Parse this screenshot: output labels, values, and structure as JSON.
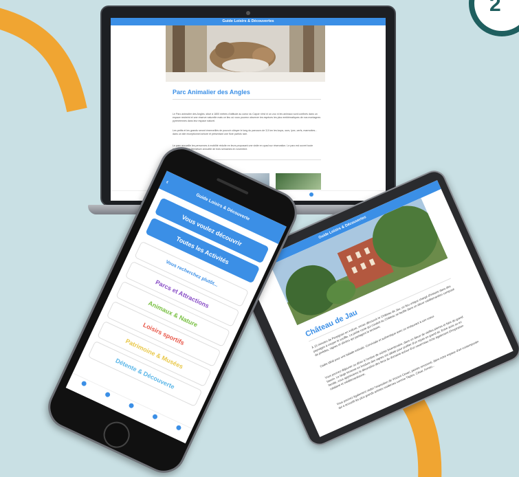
{
  "colors": {
    "background": "#c9e0e4",
    "accent": "#3b8fe6",
    "orange": "#f0a532",
    "teal_dark": "#1f5f5f"
  },
  "laptop": {
    "app_title": "Guide Loisirs & Découvertes",
    "page_title": "Parc Animalier des Angles",
    "paragraphs": [
      "Le Parc animalier des Angles, situé à 1800 mètres d'altitude au coeur du Capcir n'est ni un zoo ni les animaux sont confinés dans un espace restreint et une réserve naturelle mais ce lieu où vous pourrez observer les espèces les plus emblématiques de nos montagnes pyrénéennes dans leur espace naturel.",
      "Les petits et les grands seront émerveillés de pouvoir côtoyer le long du parcours de 3,5 km les loups, ours, lynx, cerfs, marmottes... dans un site exceptionnel arboré et présentant une flore parfois rare.",
      "Le parc accueille les personnes à mobilité réduite en leurs proposant une visite en quad sur réservation. Le parc est ouvert toute l'année sauf une fermeture annuelle de trois semaines en novembre."
    ],
    "tab_icons": [
      "search-icon",
      "calendar-icon",
      "info-icon"
    ]
  },
  "phone": {
    "app_title": "Guide Loisirs & Découverte",
    "back_label": "‹",
    "buttons": [
      {
        "label": "Vous voulez découvrir",
        "color": "#ffffff",
        "filled": true
      },
      {
        "label": "Toutes les Activités",
        "color": "#ffffff",
        "filled": true
      },
      {
        "label": "Vous recherchez plutôt...",
        "color": "#3b8fe6",
        "filled": false
      },
      {
        "label": "Parcs et Attractions",
        "color": "#8a4fc7",
        "filled": false
      },
      {
        "label": "Animaux & Nature",
        "color": "#79c043",
        "filled": false
      },
      {
        "label": "Loisirs sportifs",
        "color": "#e8584a",
        "filled": false
      },
      {
        "label": "Patrimoine & Musées",
        "color": "#e9c84a",
        "filled": false
      },
      {
        "label": "Détente & Découverte",
        "color": "#5bb6e8",
        "filled": false
      }
    ],
    "tab_icons": [
      "home-icon",
      "map-pin-icon",
      "search-icon",
      "calendar-icon",
      "info-icon"
    ]
  },
  "tablet": {
    "app_title": "Guide Loisirs & Découvertes",
    "page_title": "Château de Jau",
    "paragraphs": [
      "À 15 minutes de Perpignan en voiture, venez découvrir le Château de Jau, un lieu unique chargé d'histoire dans des paysages à couper le souffle. La petite route qui conduit au Château se faufile dans un décor méditerranéen composé de pinèdes, vignes et oliviers qui partagent le territoire.",
      "Cadre idéal pour une balade estivale. Conviviale et authentique avec un restaurant à son coeur.",
      "Vous pourrez déjeuner ou dîner à l'ombre de mûrier bicentenaire, dans un décor de vieilles pierres et faire du grand bassin. Le large terrasse en bordure des vignes est idéale pour profiter d'un repas en grand air. Entre amis ou en famille, vous apprécierez la décoration des lieux du domaine autour d'un caverneau riche également d'inspiration catalane et méditerranéenne.",
      "Vous pourrez également visiter l'exposition de Vincent Cesari, peintre renommé, dans notre espace d'art contemporain qui a accueilli les plus grands artistes modernes comme Tàpies, César, Arman..."
    ]
  }
}
